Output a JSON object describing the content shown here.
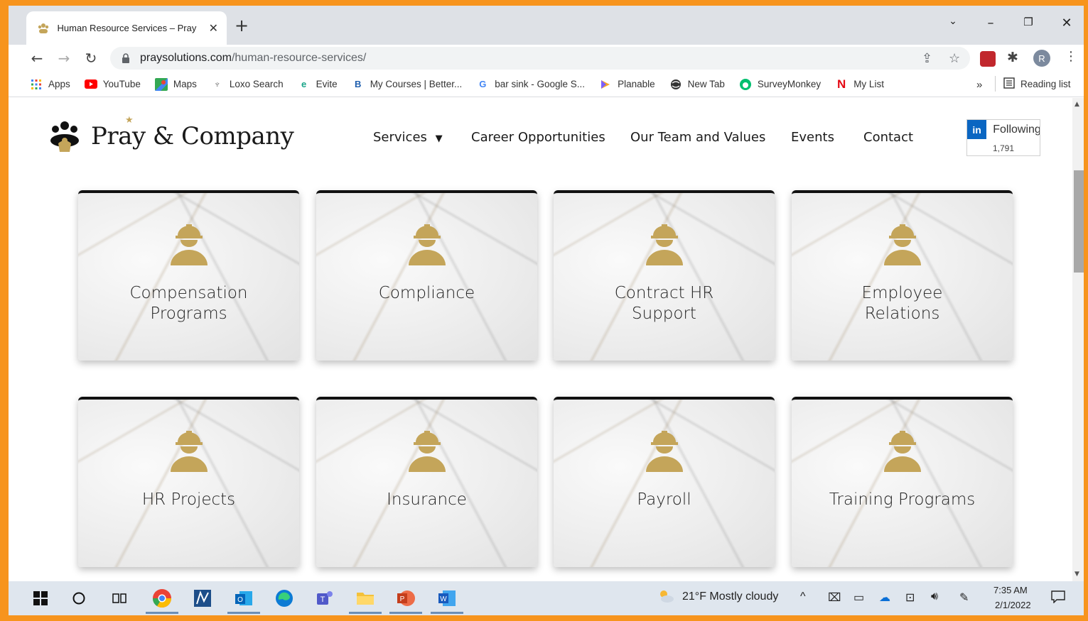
{
  "browser": {
    "tab_title": "Human Resource Services – Pray",
    "url_host": "praysolutions.com",
    "url_path": "/human-resource-services/",
    "profile_initial": "R",
    "bookmarks": [
      {
        "label": "Apps",
        "icon": "apps-grid-icon"
      },
      {
        "label": "YouTube",
        "icon": "youtube-icon"
      },
      {
        "label": "Maps",
        "icon": "maps-icon"
      },
      {
        "label": "Loxo Search",
        "icon": "loxo-icon"
      },
      {
        "label": "Evite",
        "icon": "evite-icon"
      },
      {
        "label": "My Courses | Better...",
        "icon": "betterlesson-icon"
      },
      {
        "label": "bar sink - Google S...",
        "icon": "google-icon"
      },
      {
        "label": "Planable",
        "icon": "planable-icon"
      },
      {
        "label": "New Tab",
        "icon": "globe-icon"
      },
      {
        "label": "SurveyMonkey",
        "icon": "surveymonkey-icon"
      },
      {
        "label": "My List",
        "icon": "netflix-icon"
      }
    ],
    "overflow_label": "»",
    "reading_list_label": "Reading list"
  },
  "site": {
    "logo_text": "Pray & Company",
    "nav": {
      "services": "Services",
      "career": "Career Opportunities",
      "team": "Our Team and Values",
      "events": "Events",
      "contact": "Contact"
    },
    "linkedin": {
      "badge": "in",
      "follow_label": "Following",
      "count": "1,791"
    },
    "cards": [
      {
        "line1": "Compensation",
        "line2": "Programs"
      },
      {
        "line1": "Compliance",
        "line2": ""
      },
      {
        "line1": "Contract HR",
        "line2": "Support"
      },
      {
        "line1": "Employee",
        "line2": "Relations"
      },
      {
        "line1": "HR Projects",
        "line2": ""
      },
      {
        "line1": "Insurance",
        "line2": ""
      },
      {
        "line1": "Payroll",
        "line2": ""
      },
      {
        "line1": "Training Programs",
        "line2": ""
      }
    ]
  },
  "taskbar": {
    "weather": "21°F  Mostly cloudy",
    "time": "7:35 AM",
    "date": "2/1/2022"
  },
  "colors": {
    "frame": "#f7941d",
    "gold_icon": "#c4a55a",
    "linkedin": "#0a66c2"
  }
}
